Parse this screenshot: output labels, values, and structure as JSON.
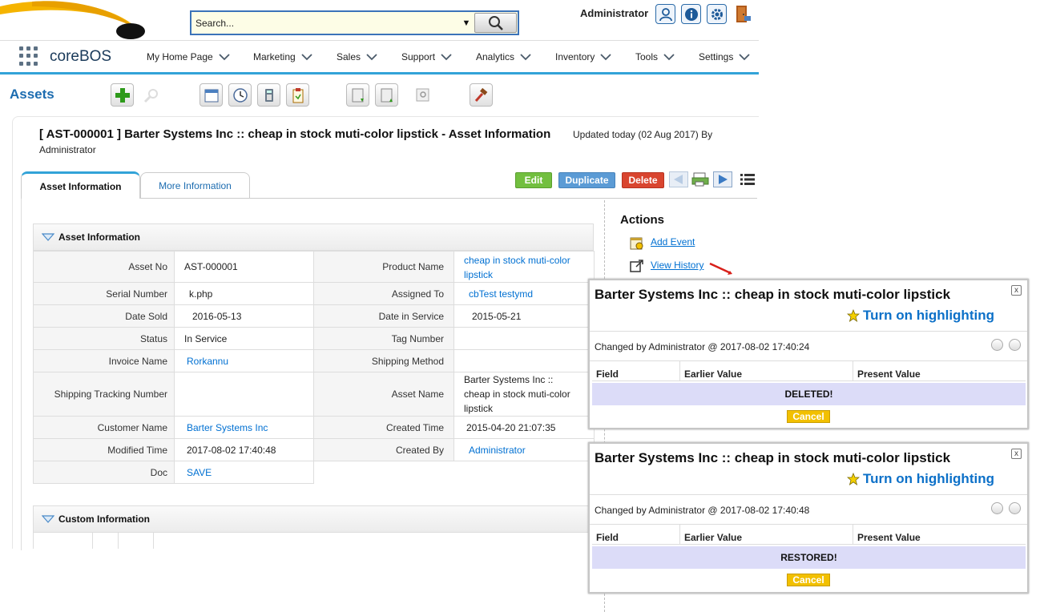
{
  "header": {
    "search_placeholder": "Search...",
    "user": "Administrator",
    "brand": "coreBOS"
  },
  "nav": {
    "items": [
      "My Home Page",
      "Marketing",
      "Sales",
      "Support",
      "Analytics",
      "Inventory",
      "Tools",
      "Settings"
    ]
  },
  "module": {
    "title": "Assets"
  },
  "record": {
    "title": "[ AST-000001 ] Barter Systems Inc :: cheap in stock muti-color lipstick - Asset Information",
    "updated": "Updated today (02 Aug 2017) By",
    "updated_by": "Administrator",
    "tabs": [
      "Asset Information",
      "More Information"
    ],
    "buttons": {
      "edit": "Edit",
      "duplicate": "Duplicate",
      "delete": "Delete"
    }
  },
  "section1": {
    "title": "Asset Information",
    "rows": [
      {
        "l1": "Asset No",
        "v1": "AST-000001",
        "l2": "Product Name",
        "v2": "cheap in stock muti-color lipstick"
      },
      {
        "l1": "Serial Number",
        "v1": "k.php",
        "l2": "Assigned To",
        "v2": "cbTest testymd"
      },
      {
        "l1": "Date Sold",
        "v1": "2016-05-13",
        "l2": "Date in Service",
        "v2": "2015-05-21"
      },
      {
        "l1": "Status",
        "v1": "In Service",
        "l2": "Tag Number",
        "v2": ""
      },
      {
        "l1": "Invoice Name",
        "v1": "Rorkannu",
        "l2": "Shipping Method",
        "v2": ""
      },
      {
        "l1": "Shipping Tracking Number",
        "v1": "",
        "l2": "Asset Name",
        "v2": "Barter Systems Inc :: cheap in stock muti-color lipstick"
      },
      {
        "l1": "Customer Name",
        "v1": "Barter Systems Inc",
        "l2": "Created Time",
        "v2": "2015-04-20 21:07:35"
      },
      {
        "l1": "Modified Time",
        "v1": "2017-08-02 17:40:48",
        "l2": "Created By",
        "v2": "Administrator"
      },
      {
        "l1": "Doc",
        "v1": "SAVE"
      }
    ]
  },
  "section2": {
    "title": "Custom Information"
  },
  "actions": {
    "title": "Actions",
    "add_event": "Add Event",
    "view_history": "View History"
  },
  "popup1": {
    "title": "Barter Systems Inc :: cheap in stock muti-color lipstick",
    "highlight": "Turn on highlighting",
    "changed": "Changed by Administrator @ 2017-08-02 17:40:24",
    "col_field": "Field",
    "col_earlier": "Earlier Value",
    "col_present": "Present Value",
    "message": "DELETED!",
    "cancel": "Cancel",
    "close": "x"
  },
  "popup2": {
    "title": "Barter Systems Inc :: cheap in stock muti-color lipstick",
    "highlight": "Turn on highlighting",
    "changed": "Changed by Administrator @ 2017-08-02 17:40:48",
    "col_field": "Field",
    "col_earlier": "Earlier Value",
    "col_present": "Present Value",
    "message": "RESTORED!",
    "cancel": "Cancel",
    "close": "x"
  },
  "colors": {
    "accent": "#32a3d8",
    "link": "#0070d2",
    "edit": "#72bf3f",
    "duplicate": "#5b9bd5",
    "delete": "#d9452f"
  }
}
